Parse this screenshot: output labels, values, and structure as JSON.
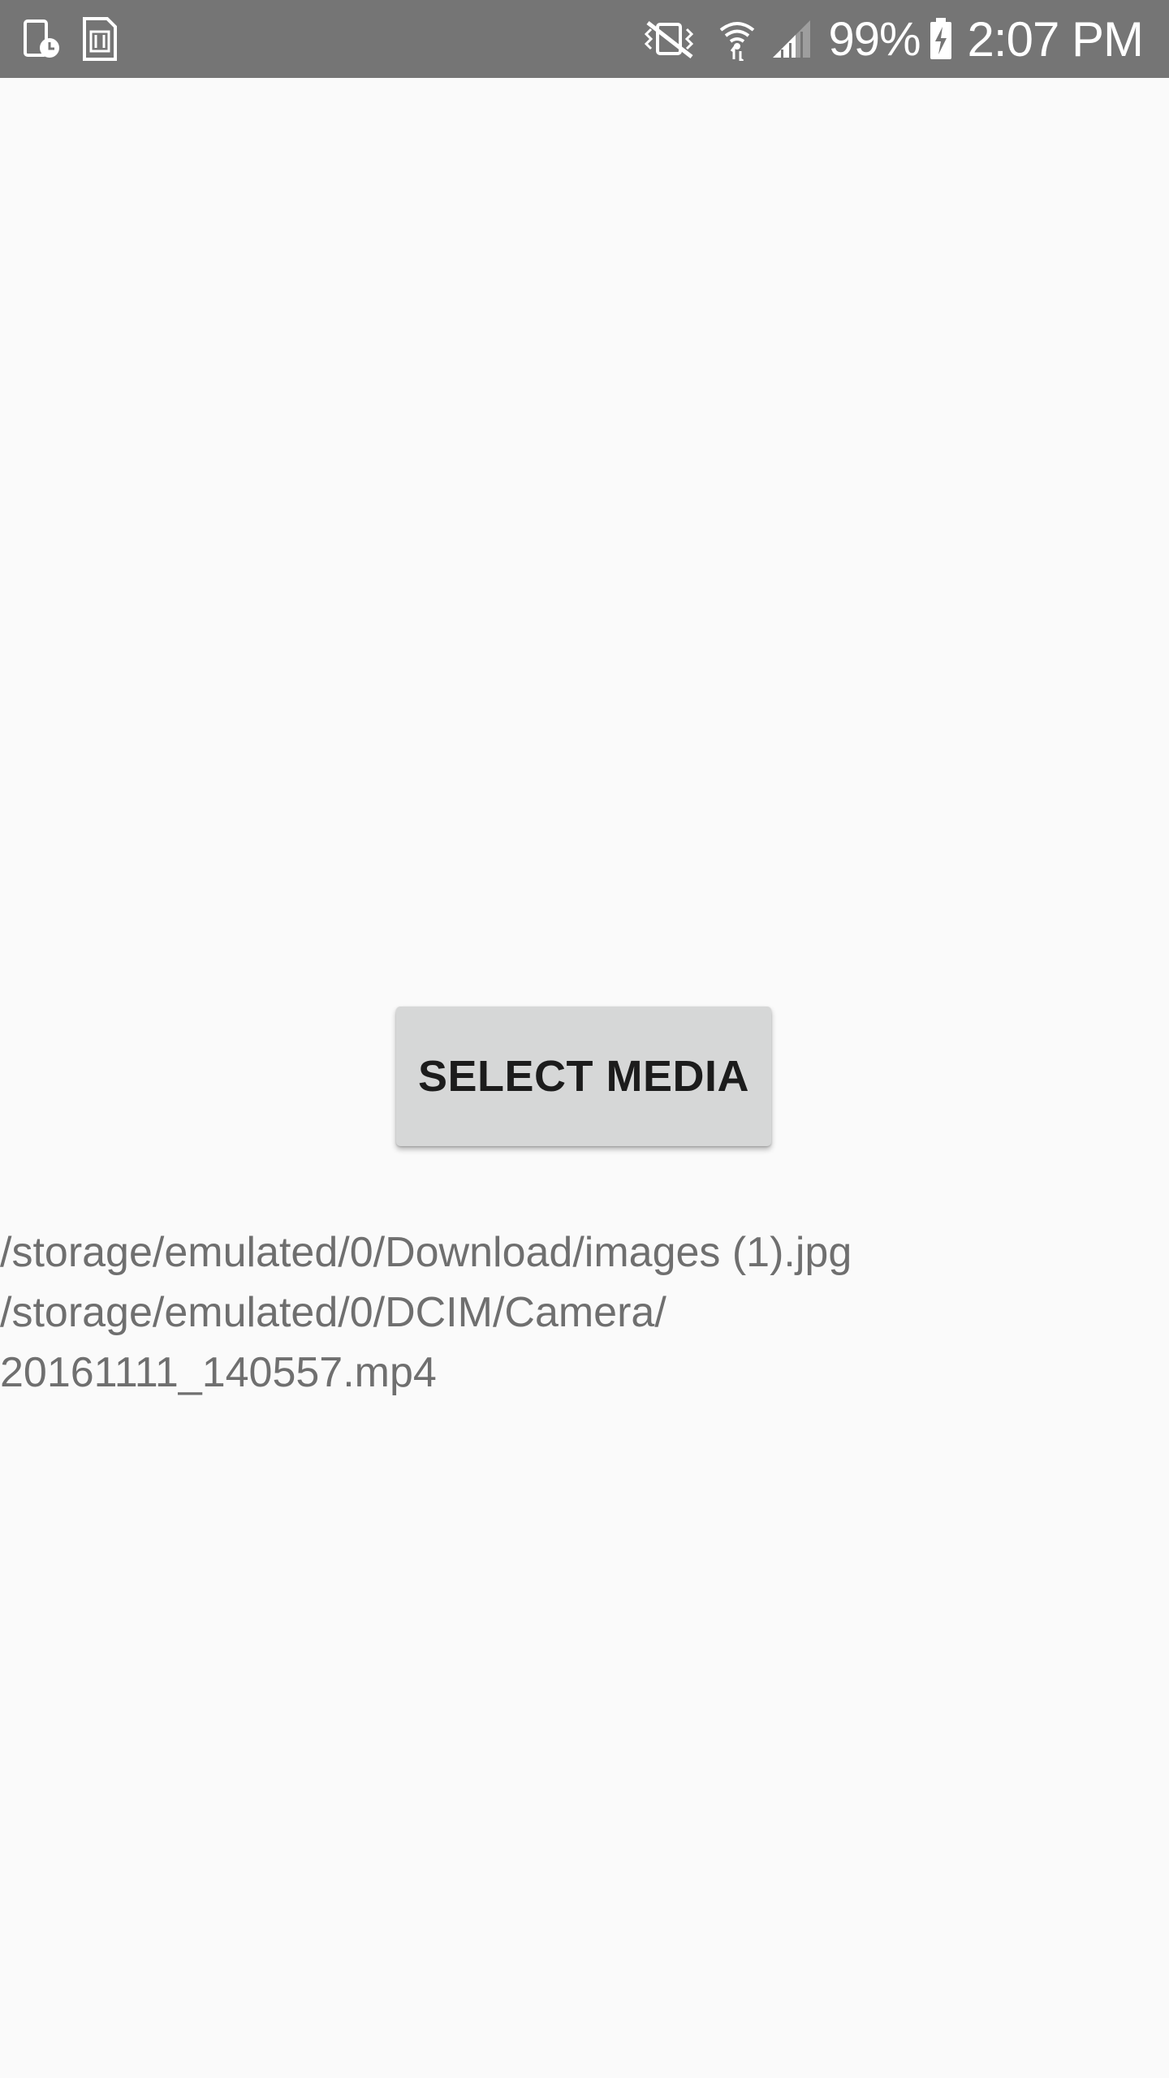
{
  "status_bar": {
    "left_icons": [
      "screenshot-clock-icon",
      "sd-card-icon"
    ],
    "right_icons": [
      "vibrate-mute-icon",
      "wifi-icon",
      "signal-icon",
      "battery-charging-icon"
    ],
    "battery_percent": "99%",
    "time": "2:07 PM",
    "background_color": "#757575"
  },
  "main": {
    "select_button_label": "SELECT MEDIA",
    "selected_paths": [
      "/storage/emulated/0/Download/images (1).jpg",
      "/storage/emulated/0/DCIM/Camera/",
      "20161111_140557.mp4"
    ]
  }
}
